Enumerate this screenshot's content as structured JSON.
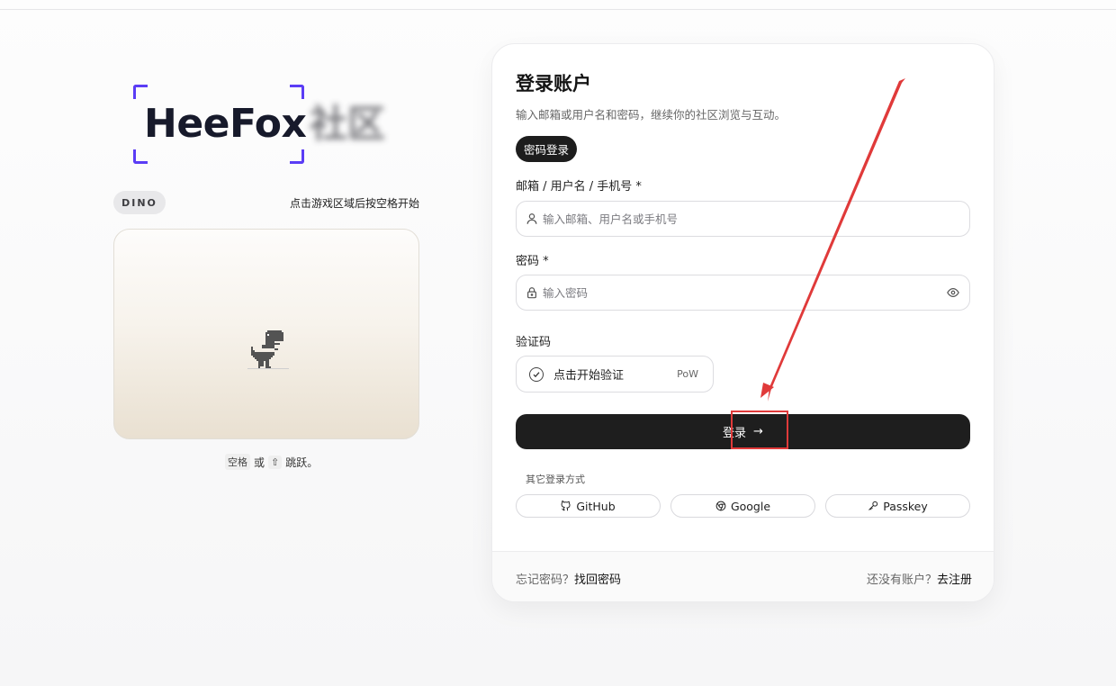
{
  "brand": {
    "name": "HeeFox",
    "suffix": "社区",
    "accent": "#5b3df5"
  },
  "game": {
    "badge": "DINO",
    "hint": "点击游戏区域后按空格开始",
    "controls": {
      "space_key": "空格",
      "or": "或",
      "up_key": "⇧",
      "jump": "跳跃。"
    }
  },
  "login": {
    "title": "登录账户",
    "subtitle": "输入邮箱或用户名和密码，继续你的社区浏览与互动。",
    "tab": "密码登录",
    "account": {
      "label": "邮箱 / 用户名 / 手机号 *",
      "placeholder": "输入邮箱、用户名或手机号",
      "value": ""
    },
    "password": {
      "label": "密码 *",
      "placeholder": "输入密码",
      "value": ""
    },
    "captcha": {
      "label": "验证码",
      "text": "点击开始验证",
      "tag": "PoW"
    },
    "submit": {
      "label": "登录",
      "arrow": "→"
    },
    "other_label": "其它登录方式",
    "providers": [
      {
        "label": "GitHub",
        "icon": "github-icon"
      },
      {
        "label": "Google",
        "icon": "chrome-icon"
      },
      {
        "label": "Passkey",
        "icon": "key-icon"
      }
    ],
    "footer": {
      "forgot_prompt": "忘记密码？",
      "forgot_link": "找回密码",
      "register_prompt": "还没有账户？",
      "register_link": "去注册"
    }
  },
  "annotation": {
    "color": "#e03a3a"
  }
}
